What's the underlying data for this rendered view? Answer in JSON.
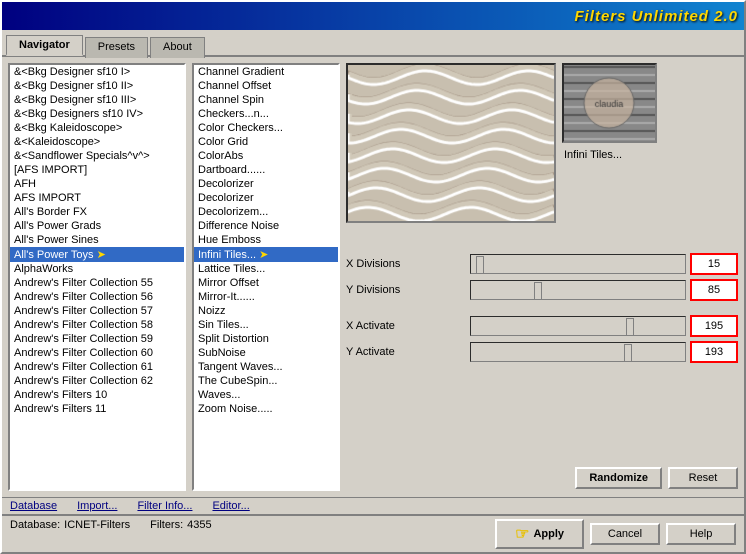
{
  "window": {
    "title": "Filters Unlimited 2.0"
  },
  "tabs": [
    {
      "label": "Navigator",
      "active": true
    },
    {
      "label": "Presets",
      "active": false
    },
    {
      "label": "About",
      "active": false
    }
  ],
  "left_list": {
    "items": [
      "&<Bkg Designer sf10 I>",
      "&<Bkg Designer sf10 II>",
      "&<Bkg Designer sf10 III>",
      "&<Bkg Designers sf10 IV>",
      "&<Bkg Kaleidoscope>",
      "&<Kaleidoscope>",
      "&<Sandflower Specials^v^>",
      "[AFS IMPORT]",
      "AFH",
      "AFS IMPORT",
      "All's Border FX",
      "All's Power Grads",
      "All's Power Sines",
      "All's Power Toys",
      "AlphaWorks",
      "Andrew's Filter Collection 55",
      "Andrew's Filter Collection 56",
      "Andrew's Filter Collection 57",
      "Andrew's Filter Collection 58",
      "Andrew's Filter Collection 59",
      "Andrew's Filter Collection 60",
      "Andrew's Filter Collection 61",
      "Andrew's Filter Collection 62",
      "Andrew's Filters 10",
      "Andrew's Filters 11"
    ],
    "selected_index": 13
  },
  "middle_list": {
    "items": [
      "Channel Gradient",
      "Channel Offset",
      "Channel Spin",
      "Checkers...n...",
      "Color Checkers...",
      "Color Grid",
      "ColorAbs",
      "Dartboard......",
      "Decolorizer",
      "Decolorizer",
      "Decolorizem...",
      "Difference Noise",
      "Hue Emboss",
      "Infini Tiles...",
      "Lattice Tiles...",
      "Mirror Offset",
      "Mirror-It......",
      "Noizz",
      "Sin Tiles...",
      "Split Distortion",
      "SubNoise",
      "Tangent Waves...",
      "The CubeSpin...",
      "Waves...",
      "Zoom Noise....."
    ],
    "selected_index": 13,
    "selected_label": "Infini Tiles..."
  },
  "preview": {
    "filter_name": "Infini Tiles...",
    "thumbnail_text": "claudia"
  },
  "parameters": [
    {
      "label": "X Divisions",
      "value": "15",
      "slider_pct": 6
    },
    {
      "label": "Y Divisions",
      "value": "85",
      "slider_pct": 33
    },
    {
      "label": "X Activate",
      "value": "195",
      "slider_pct": 76
    },
    {
      "label": "Y Activate",
      "value": "193",
      "slider_pct": 75
    }
  ],
  "buttons": {
    "randomize": "Randomize",
    "reset": "Reset"
  },
  "bottom_toolbar": {
    "database": "Database",
    "import": "Import...",
    "filter_info": "Filter Info...",
    "editor": "Editor..."
  },
  "status_bar": {
    "db_label": "Database:",
    "db_value": "ICNET-Filters",
    "filters_label": "Filters:",
    "filters_value": "4355"
  },
  "action_buttons": {
    "apply": "Apply",
    "cancel": "Cancel",
    "help": "Help"
  }
}
